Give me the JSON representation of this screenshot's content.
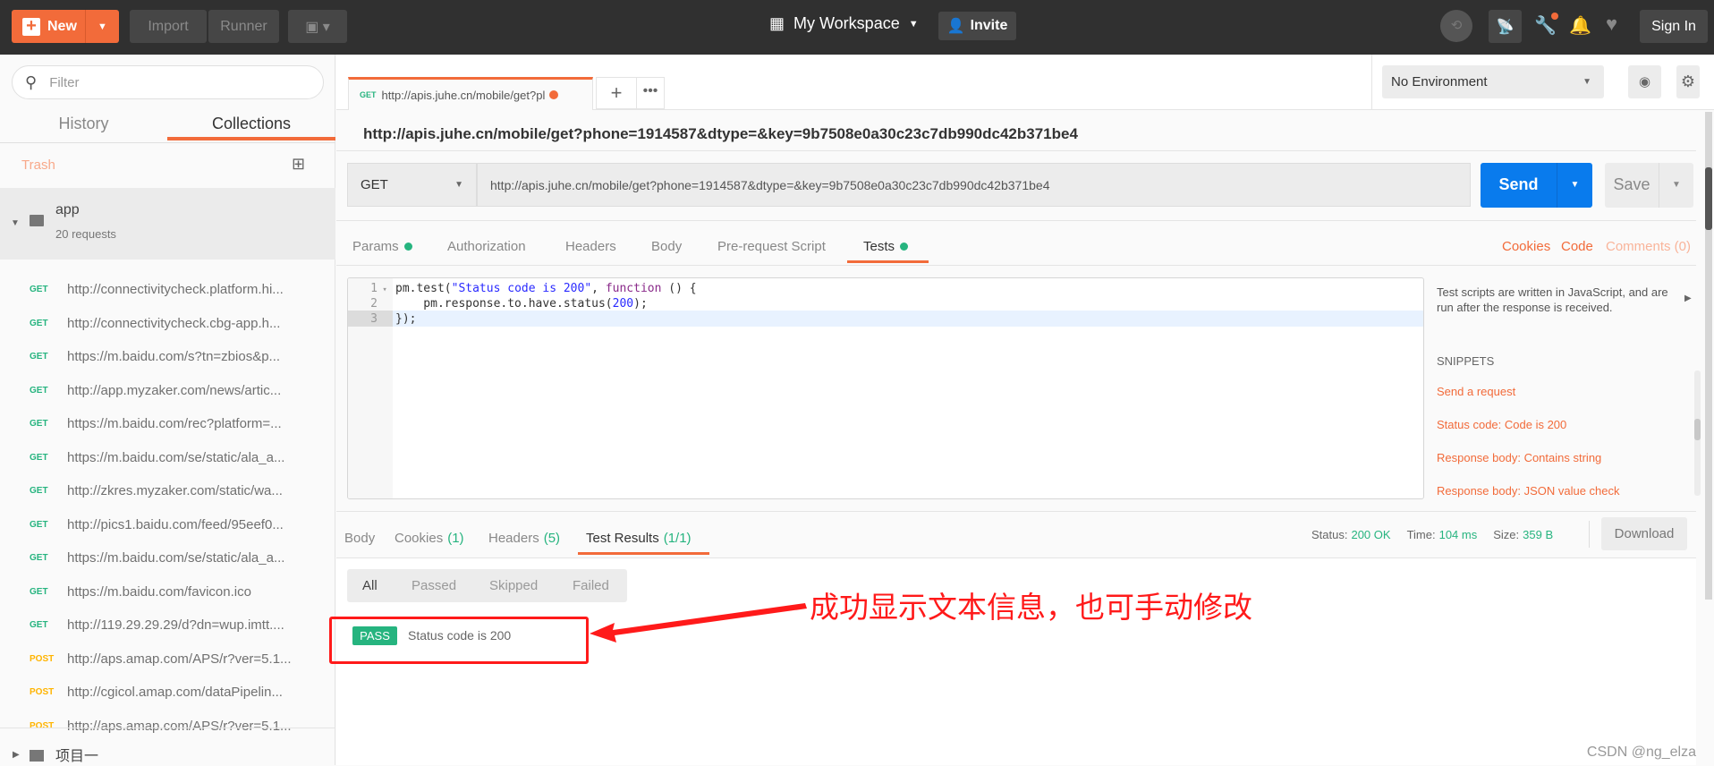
{
  "topbar": {
    "new_label": "New",
    "import_label": "Import",
    "runner_label": "Runner",
    "workspace_label": "My Workspace",
    "invite_label": "Invite",
    "signin_label": "Sign In"
  },
  "sidebar": {
    "filter_placeholder": "Filter",
    "tabs": [
      "History",
      "Collections"
    ],
    "trash_label": "Trash",
    "collection": {
      "name": "app",
      "count": "20 requests"
    },
    "requests": [
      {
        "method": "GET",
        "url": "http://connectivitycheck.platform.hi..."
      },
      {
        "method": "GET",
        "url": "http://connectivitycheck.cbg-app.h..."
      },
      {
        "method": "GET",
        "url": "https://m.baidu.com/s?tn=zbios&p..."
      },
      {
        "method": "GET",
        "url": "http://app.myzaker.com/news/artic..."
      },
      {
        "method": "GET",
        "url": "https://m.baidu.com/rec?platform=..."
      },
      {
        "method": "GET",
        "url": "https://m.baidu.com/se/static/ala_a..."
      },
      {
        "method": "GET",
        "url": "http://zkres.myzaker.com/static/wa..."
      },
      {
        "method": "GET",
        "url": "http://pics1.baidu.com/feed/95eef0..."
      },
      {
        "method": "GET",
        "url": "https://m.baidu.com/se/static/ala_a..."
      },
      {
        "method": "GET",
        "url": "https://m.baidu.com/favicon.ico"
      },
      {
        "method": "GET",
        "url": "http://119.29.29.29/d?dn=wup.imtt...."
      },
      {
        "method": "POST",
        "url": "http://aps.amap.com/APS/r?ver=5.1..."
      },
      {
        "method": "POST",
        "url": "http://cgicol.amap.com/dataPipelin..."
      },
      {
        "method": "POST",
        "url": "http://aps.amap.com/APS/r?ver=5.1..."
      }
    ],
    "collection2": {
      "name": "项目一"
    }
  },
  "request_tab": {
    "method": "GET",
    "label": "http://apis.juhe.cn/mobile/get?pl"
  },
  "environment": {
    "selected": "No Environment"
  },
  "request": {
    "title": "http://apis.juhe.cn/mobile/get?phone=1914587&dtype=&key=9b7508e0a30c23c7db990dc42b371be4",
    "method": "GET",
    "url": "http://apis.juhe.cn/mobile/get?phone=1914587&dtype=&key=9b7508e0a30c23c7db990dc42b371be4",
    "send_label": "Send",
    "save_label": "Save"
  },
  "subtabs": [
    "Params",
    "Authorization",
    "Headers",
    "Body",
    "Pre-request Script",
    "Tests"
  ],
  "sublinks": {
    "cookies": "Cookies",
    "code": "Code",
    "comments": "Comments (0)"
  },
  "editor": {
    "lines": [
      {
        "n": "1",
        "a": "pm.test(",
        "s": "\"Status code is 200\"",
        "b": ", ",
        "k": "function",
        "c": " () {"
      },
      {
        "n": "2",
        "a": "    pm.response.to.have.status(",
        "num": "200",
        "c": ");"
      },
      {
        "n": "3",
        "a": "});"
      }
    ]
  },
  "snippets": {
    "help": "Test scripts are written in JavaScript, and are run after the response is received.",
    "heading": "SNIPPETS",
    "items": [
      "Send a request",
      "Status code: Code is 200",
      "Response body: Contains string",
      "Response body: JSON value check"
    ]
  },
  "response": {
    "tabs": [
      {
        "label": "Body",
        "count": ""
      },
      {
        "label": "Cookies",
        "count": "(1)"
      },
      {
        "label": "Headers",
        "count": "(5)"
      },
      {
        "label": "Test Results",
        "count": "(1/1)"
      }
    ],
    "status_label": "Status:",
    "status": "200 OK",
    "time_label": "Time:",
    "time": "104 ms",
    "size_label": "Size:",
    "size": "359 B",
    "download_label": "Download",
    "filters": [
      "All",
      "Passed",
      "Skipped",
      "Failed"
    ],
    "results": [
      {
        "badge": "PASS",
        "name": "Status code is 200"
      }
    ]
  },
  "annotation": {
    "text": "成功显示文本信息，也可手动修改",
    "color": "#ff0000"
  },
  "watermark": "CSDN @ng_elza",
  "colors": {
    "accent": "#f26b3a",
    "send": "#097bed",
    "pass": "#26b47f"
  }
}
